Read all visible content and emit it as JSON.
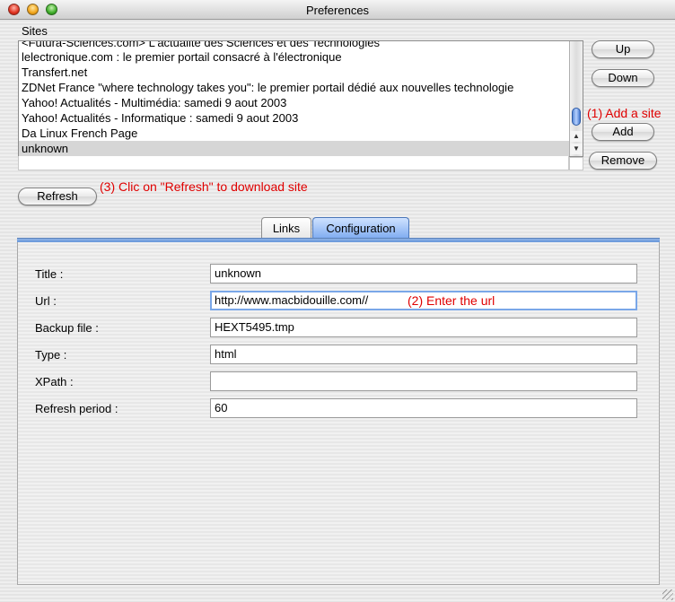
{
  "window": {
    "title": "Preferences"
  },
  "sites": {
    "label": "Sites",
    "items": [
      "<Futura-Sciences.com> L'actualité des Sciences et des Technologies",
      "lelectronique.com : le premier portail consacré à l'électronique",
      "Transfert.net",
      "ZDNet France \"where technology takes you\": le premier portail dédié aux nouvelles technologie",
      "Yahoo! Actualités - Multimédia: samedi 9 aout 2003",
      "Yahoo! Actualités - Informatique : samedi 9 aout 2003",
      "Da Linux French Page",
      "unknown"
    ],
    "selected": "unknown"
  },
  "buttons": {
    "up": "Up",
    "down": "Down",
    "add": "Add",
    "remove": "Remove",
    "refresh": "Refresh"
  },
  "annotations": {
    "add_site": "(1) Add a site",
    "enter_url": "(2) Enter the url",
    "refresh_hint": "(3) Clic on \"Refresh\" to download site"
  },
  "tabs": [
    {
      "label": "Links",
      "active": false
    },
    {
      "label": "Configuration",
      "active": true
    }
  ],
  "config": {
    "title": {
      "label": "Title :",
      "value": "unknown"
    },
    "url": {
      "label": "Url :",
      "value": "http://www.macbidouille.com//"
    },
    "backup": {
      "label": "Backup file :",
      "value": "HEXT5495.tmp"
    },
    "type": {
      "label": "Type :",
      "value": "html"
    },
    "xpath": {
      "label": "XPath :",
      "value": ""
    },
    "refresh_period": {
      "label": "Refresh period :",
      "value": "60"
    }
  },
  "colors": {
    "annotation": "#e00000",
    "accent": "#5d8fd6"
  }
}
